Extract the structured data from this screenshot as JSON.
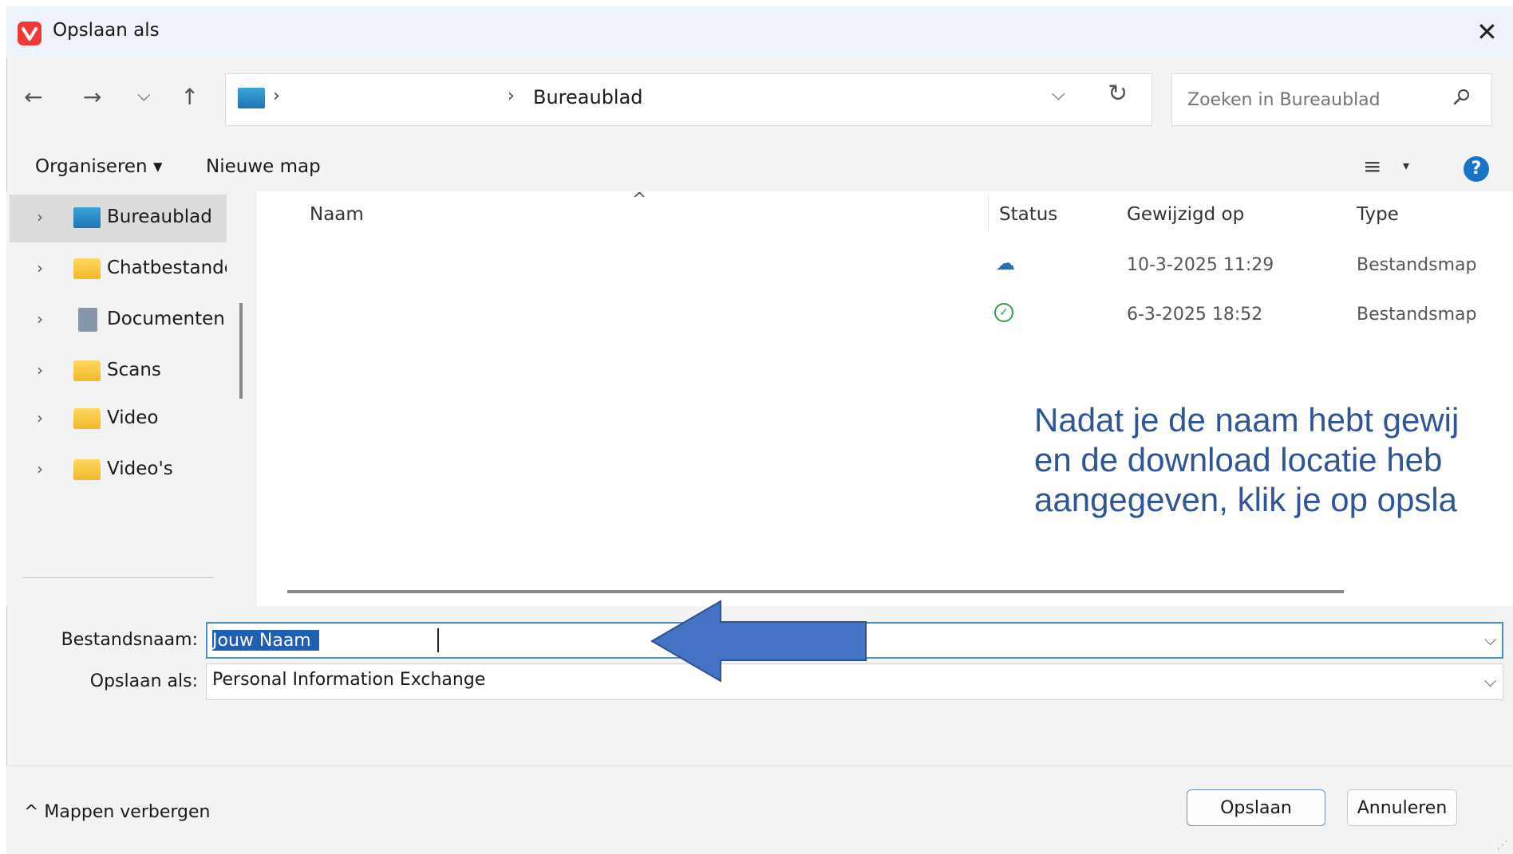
{
  "window": {
    "title": "Opslaan als",
    "close_glyph": "✕"
  },
  "nav": {
    "back_glyph": "←",
    "forward_glyph": "→",
    "recent_glyph": "⌵",
    "up_glyph": "↑",
    "breadcrumb_sep": "›",
    "current_folder": "Bureaublad",
    "address_chevron": "⌵",
    "refresh_glyph": "↻",
    "search_placeholder": "Zoeken in Bureaublad"
  },
  "commandbar": {
    "organize": "Organiseren ▾",
    "new_folder": "Nieuwe map",
    "view_glyph": "≡",
    "view_chevron": "▾",
    "help": "?"
  },
  "sidebar": {
    "items": [
      {
        "label": "Bureaublad",
        "icon": "desktop-icon"
      },
      {
        "label": "Chatbestanden",
        "icon": "folder-icon"
      },
      {
        "label": "Documenten",
        "icon": "documents-icon"
      },
      {
        "label": "Scans",
        "icon": "folder-icon"
      },
      {
        "label": "Video",
        "icon": "folder-icon"
      },
      {
        "label": "Video's",
        "icon": "folder-icon"
      }
    ],
    "expand_glyph": "›"
  },
  "filelist": {
    "columns": {
      "name": "Naam",
      "status": "Status",
      "modified": "Gewijzigd op",
      "type": "Type"
    },
    "sort_glyph": "^",
    "rows": [
      {
        "name": "",
        "status": "cloud",
        "status_glyph": "☁",
        "modified": "10-3-2025 11:29",
        "type": "Bestandsmap"
      },
      {
        "name": "",
        "status": "synced",
        "status_glyph": "✓",
        "modified": "6-3-2025 18:52",
        "type": "Bestandsmap"
      }
    ]
  },
  "annotation": {
    "lines": [
      "Nadat je de naam hebt gewij",
      "en de download locatie heb",
      "aangegeven, klik je op opsla"
    ],
    "color": "#2f5597",
    "arrow_color": "#4472c4"
  },
  "form": {
    "filename_label": "Bestandsnaam:",
    "filename_value": "Jouw Naam",
    "savetype_label": "Opslaan als:",
    "savetype_value": "Personal Information Exchange",
    "chevron": "⌵"
  },
  "footer": {
    "hide_folders": "^ Mappen verbergen",
    "save": "Opslaan",
    "cancel": "Annuleren",
    "grip": "⋰"
  }
}
